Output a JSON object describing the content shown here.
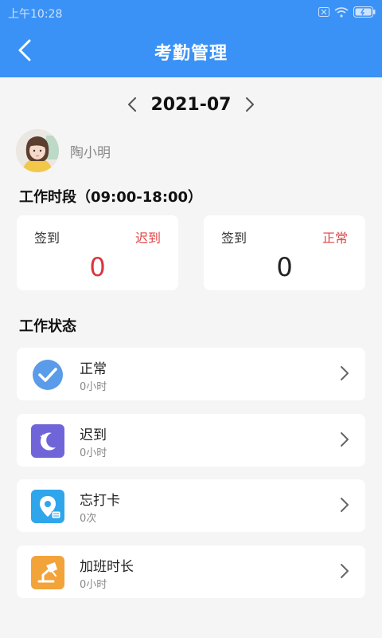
{
  "status_bar": {
    "time": "上午10:28"
  },
  "header": {
    "title": "考勤管理",
    "back_icon": "chevron-left-icon"
  },
  "month_selector": {
    "value": "2021-07"
  },
  "user": {
    "name": "陶小明"
  },
  "work_period": {
    "title": "工作时段（09:00-18:00）"
  },
  "stats": [
    {
      "label": "签到",
      "type": "迟到",
      "value": "0",
      "value_color": "#d9363e"
    },
    {
      "label": "签到",
      "type": "正常",
      "value": "0",
      "value_color": "#222222"
    }
  ],
  "work_status": {
    "title": "工作状态",
    "items": [
      {
        "title": "正常",
        "sub": "0小时",
        "icon": "check-circle-icon",
        "color": "#4a90e2"
      },
      {
        "title": "迟到",
        "sub": "0小时",
        "icon": "moon-icon",
        "color": "#7065d8"
      },
      {
        "title": "忘打卡",
        "sub": "0次",
        "icon": "location-pin-icon",
        "color": "#2fa6ec"
      },
      {
        "title": "加班时长",
        "sub": "0小时",
        "icon": "desk-lamp-icon",
        "color": "#f2a33a"
      }
    ]
  },
  "colors": {
    "primary": "#3a92f6",
    "late_red": "#e04848",
    "background": "#f5f5f5"
  }
}
